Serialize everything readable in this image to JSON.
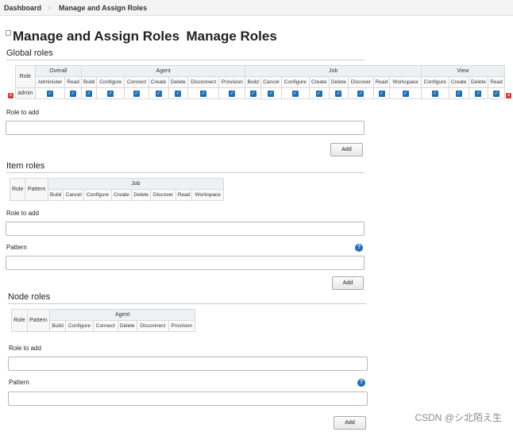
{
  "breadcrumb": {
    "home": "Dashboard",
    "sep": "›",
    "current": "Manage and Assign Roles"
  },
  "header": {
    "broken_image_alt": "Manage and Assign Roles",
    "title": "Manage Roles"
  },
  "global_roles": {
    "title": "Global roles",
    "role_header": "Role",
    "groups": [
      {
        "label": "Overall",
        "perms": [
          "Administer",
          "Read"
        ]
      },
      {
        "label": "Agent",
        "perms": [
          "Build",
          "Configure",
          "Connect",
          "Create",
          "Delete",
          "Disconnect",
          "Provision"
        ]
      },
      {
        "label": "Job",
        "perms": [
          "Build",
          "Cancel",
          "Configure",
          "Create",
          "Delete",
          "Discover",
          "Read",
          "Workspace"
        ]
      },
      {
        "label": "View",
        "perms": [
          "Configure",
          "Create",
          "Delete",
          "Read"
        ]
      }
    ],
    "rows": [
      {
        "role": "admin",
        "checked": true
      }
    ],
    "role_to_add_label": "Role to add",
    "add_label": "Add"
  },
  "item_roles": {
    "title": "Item roles",
    "role_header": "Role",
    "pattern_header": "Pattern",
    "group": "Job",
    "perms": [
      "Build",
      "Cancel",
      "Configure",
      "Create",
      "Delete",
      "Discover",
      "Read",
      "Workspace"
    ],
    "role_to_add_label": "Role to add",
    "pattern_label": "Pattern",
    "add_label": "Add"
  },
  "node_roles": {
    "title": "Node roles",
    "role_header": "Role",
    "pattern_header": "Pattern",
    "group": "Agent",
    "perms": [
      "Build",
      "Configure",
      "Connect",
      "Delete",
      "Disconnect",
      "Provision"
    ],
    "role_to_add_label": "Role to add",
    "pattern_label": "Pattern",
    "add_label": "Add"
  },
  "help_icon": "?",
  "delete_icon": "x",
  "watermark": "CSDN @シ北陌え生",
  "colors": {
    "checkbox": "#1f6fb5",
    "delete": "#d43c3c",
    "help": "#1f6fb5"
  }
}
